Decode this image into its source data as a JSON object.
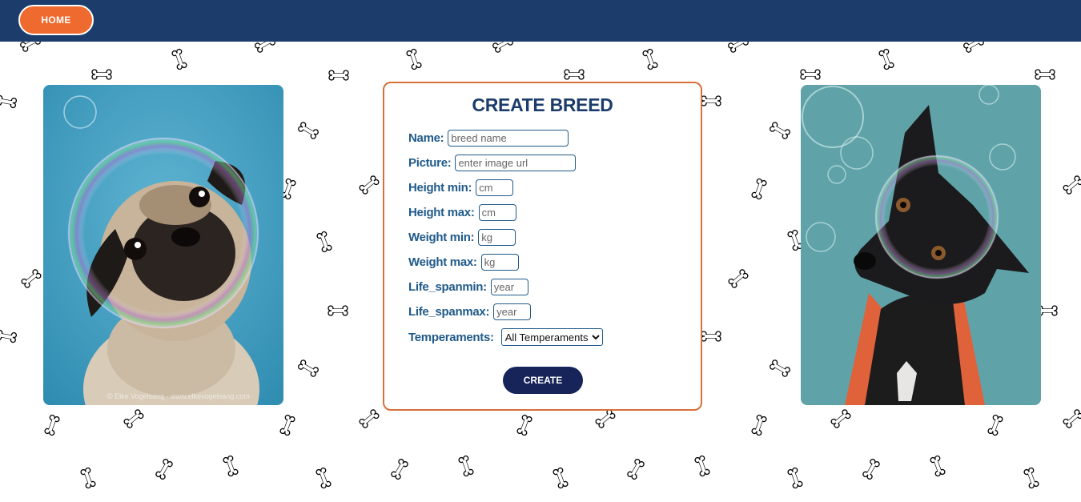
{
  "nav": {
    "home_label": "HOME"
  },
  "form": {
    "title": "CREATE BREED",
    "fields": [
      {
        "label": "Name:",
        "placeholder": "breed name"
      },
      {
        "label": "Picture:",
        "placeholder": "enter image url"
      },
      {
        "label": "Height min:",
        "placeholder": "cm"
      },
      {
        "label": "Height max:",
        "placeholder": "cm"
      },
      {
        "label": "Weight min:",
        "placeholder": "kg"
      },
      {
        "label": "Weight max:",
        "placeholder": "kg"
      },
      {
        "label": "Life_spanmin:",
        "placeholder": "year"
      },
      {
        "label": "Life_spanmax:",
        "placeholder": "year"
      }
    ],
    "temperaments": {
      "label": "Temperaments:",
      "selected": "All Temperaments"
    },
    "submit_label": "CREATE"
  },
  "images": {
    "left": {
      "subject": "pug-in-bubble",
      "watermark": "© Elke Vogelsang - www.elkevogelsang.com"
    },
    "right": {
      "subject": "black-dog-in-bubble-with-towel"
    }
  },
  "colors": {
    "nav_bg": "#1c3d6b",
    "accent_orange": "#ef6a2f",
    "title": "#1c3d6b",
    "label": "#1f5a8a",
    "submit_bg": "#16245a",
    "card_border": "#d57039"
  }
}
